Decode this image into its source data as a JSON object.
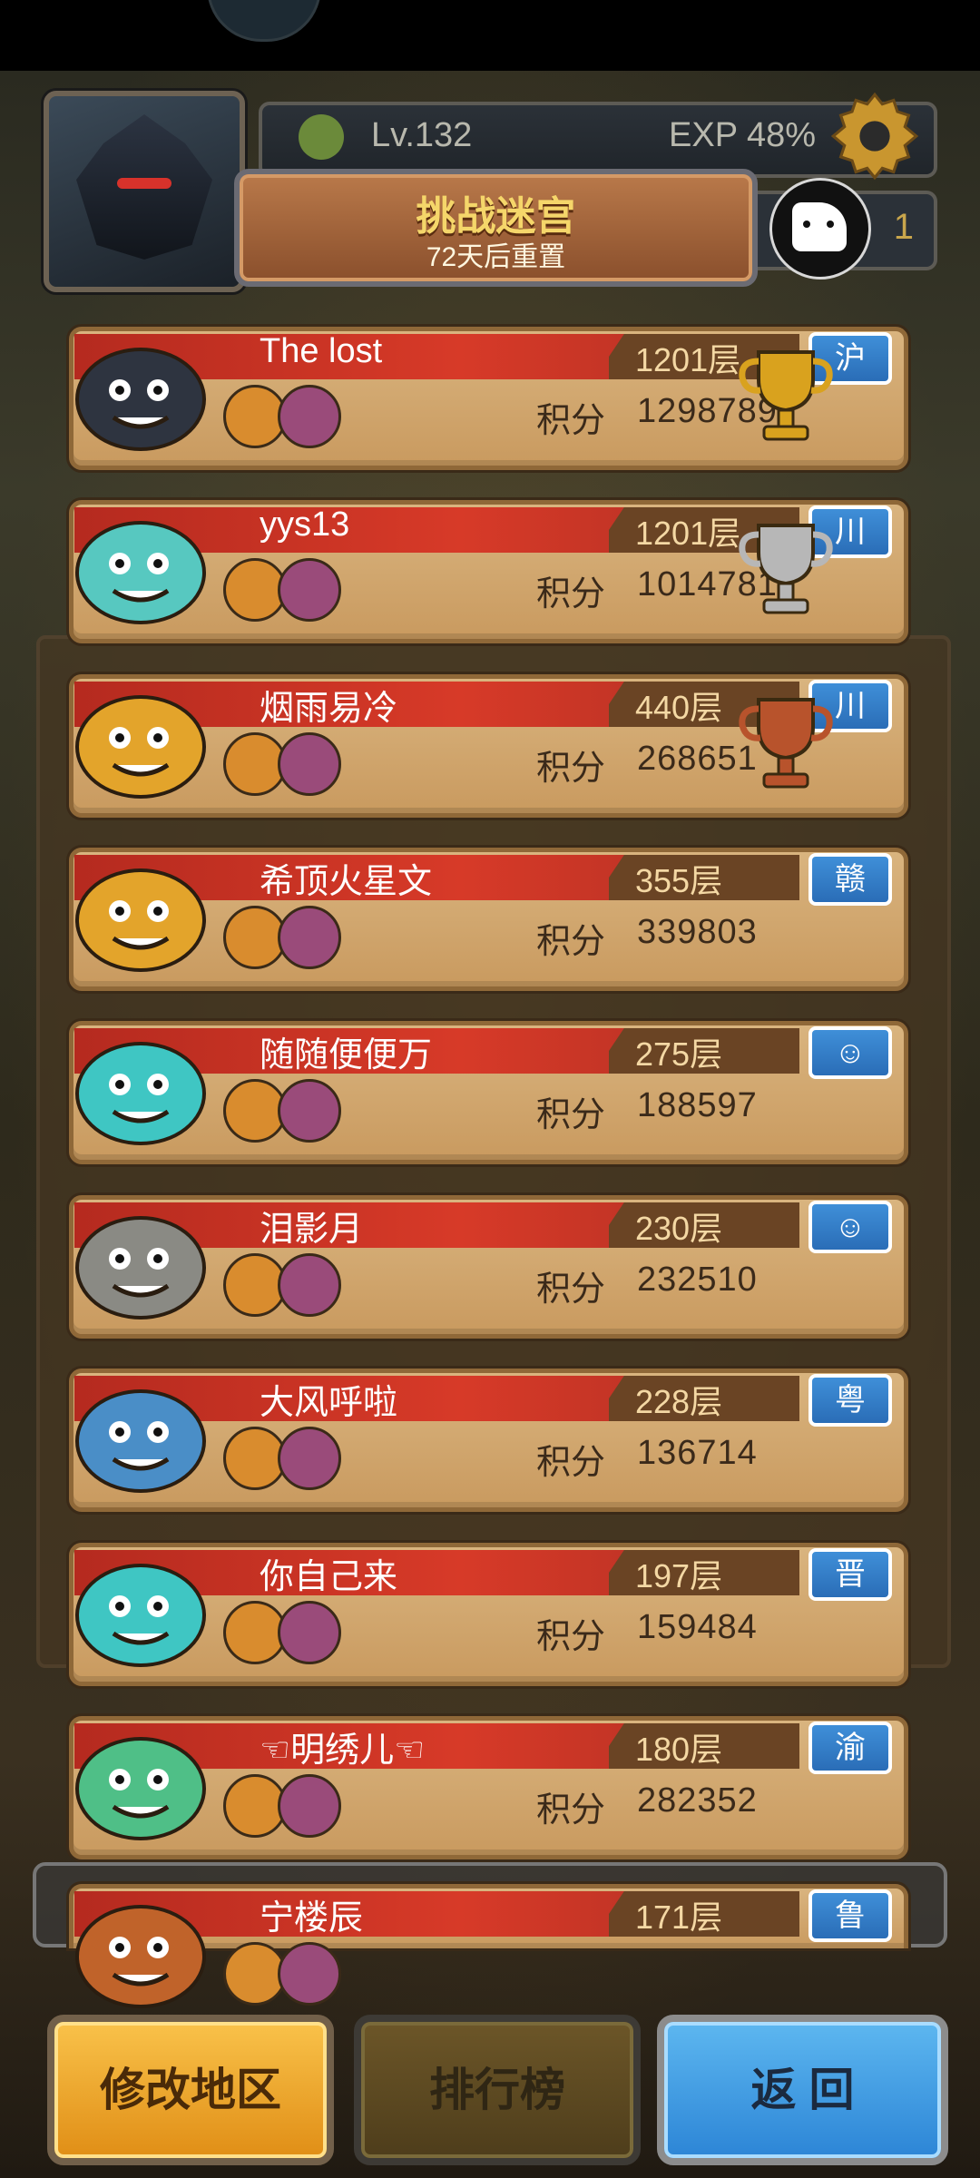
{
  "header": {
    "level": "Lv.132",
    "exp": "EXP 48%",
    "plaque_title": "挑战迷宫",
    "plaque_sub": "72天后重置",
    "counter_partial": "1"
  },
  "rows": [
    {
      "name": "The lost",
      "floor": "1201层",
      "score_label": "积分",
      "score": "1298789",
      "region": "沪",
      "trophy": "gold",
      "pet_color": "#2e3440"
    },
    {
      "name": "yys13",
      "floor": "1201层",
      "score_label": "积分",
      "score": "1014781",
      "region": "川",
      "trophy": "silver",
      "pet_color": "#57c8c0"
    },
    {
      "name": "烟雨易冷",
      "floor": "440层",
      "score_label": "积分",
      "score": "268651",
      "region": "川",
      "trophy": "bronze",
      "pet_color": "#e3a42b"
    },
    {
      "name": "希顶火星文",
      "floor": "355层",
      "score_label": "积分",
      "score": "339803",
      "region": "赣",
      "trophy": "",
      "pet_color": "#e3a42b"
    },
    {
      "name": "随随便便万",
      "floor": "275层",
      "score_label": "积分",
      "score": "188597",
      "region": "☺",
      "trophy": "",
      "pet_color": "#3fc6c3"
    },
    {
      "name": "泪影月",
      "floor": "230层",
      "score_label": "积分",
      "score": "232510",
      "region": "☺",
      "trophy": "",
      "pet_color": "#8a8a84"
    },
    {
      "name": "大风呼啦",
      "floor": "228层",
      "score_label": "积分",
      "score": "136714",
      "region": "粤",
      "trophy": "",
      "pet_color": "#4a8ec7"
    },
    {
      "name": "你自己来",
      "floor": "197层",
      "score_label": "积分",
      "score": "159484",
      "region": "晋",
      "trophy": "",
      "pet_color": "#3fc6c3"
    },
    {
      "name": "☜明绣儿☜",
      "floor": "180层",
      "score_label": "积分",
      "score": "282352",
      "region": "渝",
      "trophy": "",
      "pet_color": "#4fbf87"
    },
    {
      "name": "宁楼辰",
      "floor": "171层",
      "score_label": "",
      "score": "",
      "region": "鲁",
      "trophy": "",
      "pet_color": "#c0632a"
    }
  ],
  "buttons": {
    "change_region": "修改地区",
    "leaderboard": "排行榜",
    "back": "返 回"
  },
  "colors": {
    "red_band": "#d73a28",
    "panel": "#d9b47f",
    "region_blue": "#2a6db7",
    "gold": "#d9a21e",
    "silver": "#b7b7b7",
    "bronze": "#b8532c"
  }
}
